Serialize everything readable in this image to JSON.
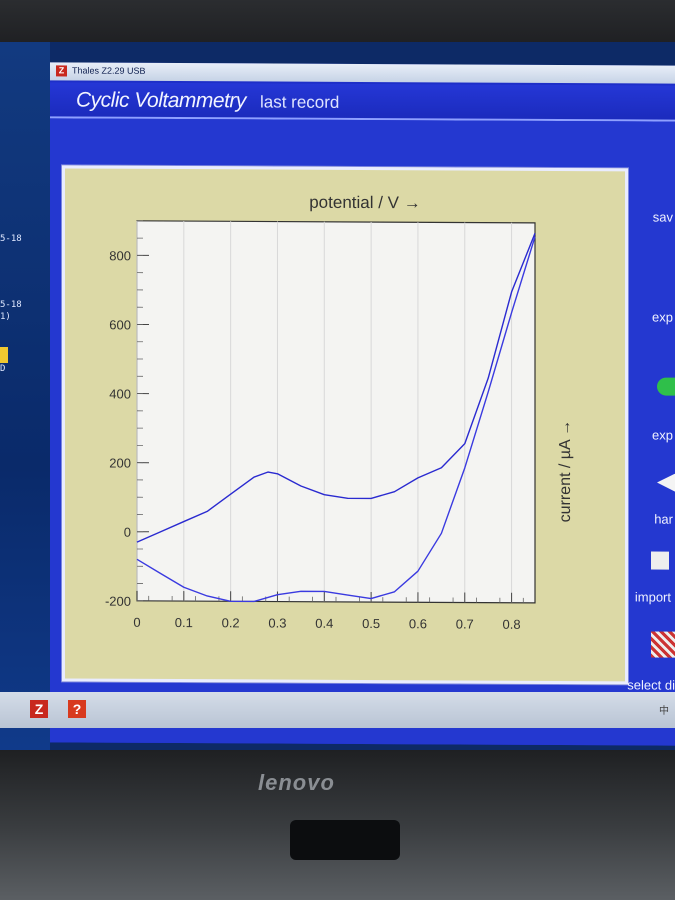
{
  "app": {
    "window_title": "Thales Z2.29 USB",
    "heading_title": "Cyclic Voltammetry",
    "heading_sub": "last record"
  },
  "desktop": {
    "labels": [
      "5-18",
      "5-18",
      "1)",
      "D"
    ]
  },
  "sidebar": {
    "items": [
      {
        "label": "sav"
      },
      {
        "label": "exp"
      },
      {
        "label": "exp"
      },
      {
        "label": "har"
      },
      {
        "label": "import"
      },
      {
        "label": "select di"
      }
    ]
  },
  "taskbar": {
    "buttons": [
      "Z",
      "?"
    ],
    "tray_text": "中"
  },
  "monitor": {
    "brand": "lenovo"
  },
  "chart_data": {
    "type": "line",
    "title": "",
    "xlabel": "potential / V →",
    "ylabel": "current / µA →",
    "xlim": [
      0,
      0.85
    ],
    "ylim": [
      -200,
      900
    ],
    "x_ticks": [
      "0",
      "0.1",
      "0.2",
      "0.3",
      "0.4",
      "0.5",
      "0.6",
      "0.7",
      "0.8"
    ],
    "y_ticks": [
      "800",
      "600",
      "400",
      "200",
      "0",
      "-200"
    ],
    "series": [
      {
        "color": "#2a2ad0",
        "x": [
          0.0,
          0.05,
          0.1,
          0.15,
          0.2,
          0.25,
          0.28,
          0.3,
          0.35,
          0.4,
          0.45,
          0.5,
          0.55,
          0.6,
          0.65,
          0.7,
          0.75,
          0.8,
          0.85
        ],
        "y": [
          -30,
          0,
          30,
          60,
          110,
          160,
          175,
          170,
          135,
          110,
          100,
          100,
          120,
          160,
          190,
          260,
          450,
          700,
          870
        ]
      },
      {
        "color": "#3a3ae0",
        "x": [
          0.85,
          0.8,
          0.75,
          0.7,
          0.65,
          0.6,
          0.55,
          0.5,
          0.45,
          0.4,
          0.35,
          0.3,
          0.25,
          0.2,
          0.15,
          0.1,
          0.05,
          0.0
        ],
        "y": [
          860,
          640,
          410,
          190,
          0,
          -110,
          -170,
          -190,
          -180,
          -170,
          -170,
          -180,
          -200,
          -200,
          -185,
          -160,
          -120,
          -80
        ]
      }
    ],
    "grid": true,
    "legend": "none"
  }
}
